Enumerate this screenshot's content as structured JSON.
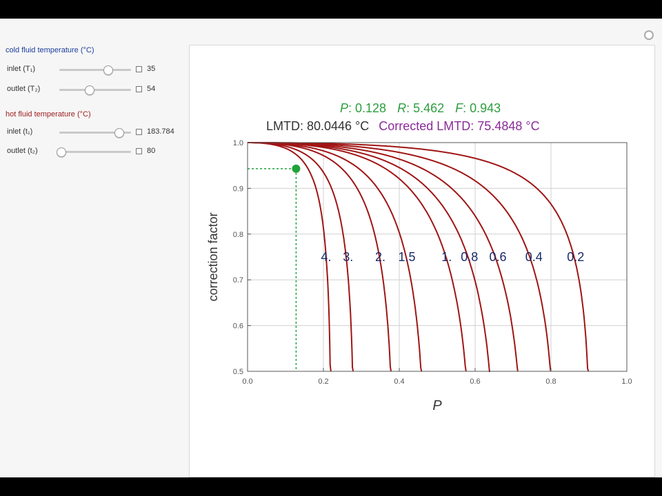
{
  "controls": {
    "cold": {
      "title": "cold fluid temperature (°C)",
      "inlet": {
        "label": "inlet (T₁)",
        "value": "35",
        "fraction": 0.68
      },
      "outlet": {
        "label": "outlet (T₂)",
        "value": "54",
        "fraction": 0.42
      }
    },
    "hot": {
      "title": "hot fluid temperature (°C)",
      "inlet": {
        "label": "inlet (t₁)",
        "value": "183.784",
        "fraction": 0.84
      },
      "outlet": {
        "label": "outlet (t₂)",
        "value": "80",
        "fraction": 0.03
      }
    }
  },
  "info": {
    "p_label": "P",
    "p_value": ": 0.128",
    "r_label": "R",
    "r_value": ": 5.462",
    "f_label": "F",
    "f_value": ": 0.943",
    "lmtd": "LMTD: 80.0446 °C",
    "corrected": "Corrected LMTD: 75.4848 °C"
  },
  "colors": {
    "curve": "#a01414",
    "marker": "#1fa33a",
    "info_green": "#2e9e3e",
    "info_purple": "#8b2a9b",
    "cold_title": "#1c3d9c",
    "hot_title": "#9b1c1c"
  },
  "chart_data": {
    "type": "line",
    "xlabel": "P",
    "ylabel": "correction factor",
    "xlim": [
      0,
      1
    ],
    "ylim": [
      0.5,
      1.0
    ],
    "x_ticks": [
      "0.0",
      "0.2",
      "0.4",
      "0.6",
      "0.8",
      "1.0"
    ],
    "y_ticks": [
      "0.5",
      "0.6",
      "0.7",
      "0.8",
      "0.9",
      "1.0"
    ],
    "grid": true,
    "series": [
      {
        "name": "4.",
        "R": 4,
        "label_at": [
          0.207,
          0.75
        ]
      },
      {
        "name": "3.",
        "R": 3,
        "label_at": [
          0.265,
          0.75
        ]
      },
      {
        "name": "2.",
        "R": 2,
        "label_at": [
          0.35,
          0.75
        ]
      },
      {
        "name": "1.5",
        "R": 1.5,
        "label_at": [
          0.42,
          0.75
        ]
      },
      {
        "name": "1.",
        "R": 1,
        "label_at": [
          0.525,
          0.75
        ]
      },
      {
        "name": "0.8",
        "R": 0.8,
        "label_at": [
          0.585,
          0.75
        ]
      },
      {
        "name": "0.6",
        "R": 0.6,
        "label_at": [
          0.66,
          0.75
        ]
      },
      {
        "name": "0.4",
        "R": 0.4,
        "label_at": [
          0.755,
          0.75
        ]
      },
      {
        "name": "0.2",
        "R": 0.2,
        "label_at": [
          0.865,
          0.75
        ]
      }
    ],
    "marker": {
      "x": 0.128,
      "y": 0.943
    }
  }
}
